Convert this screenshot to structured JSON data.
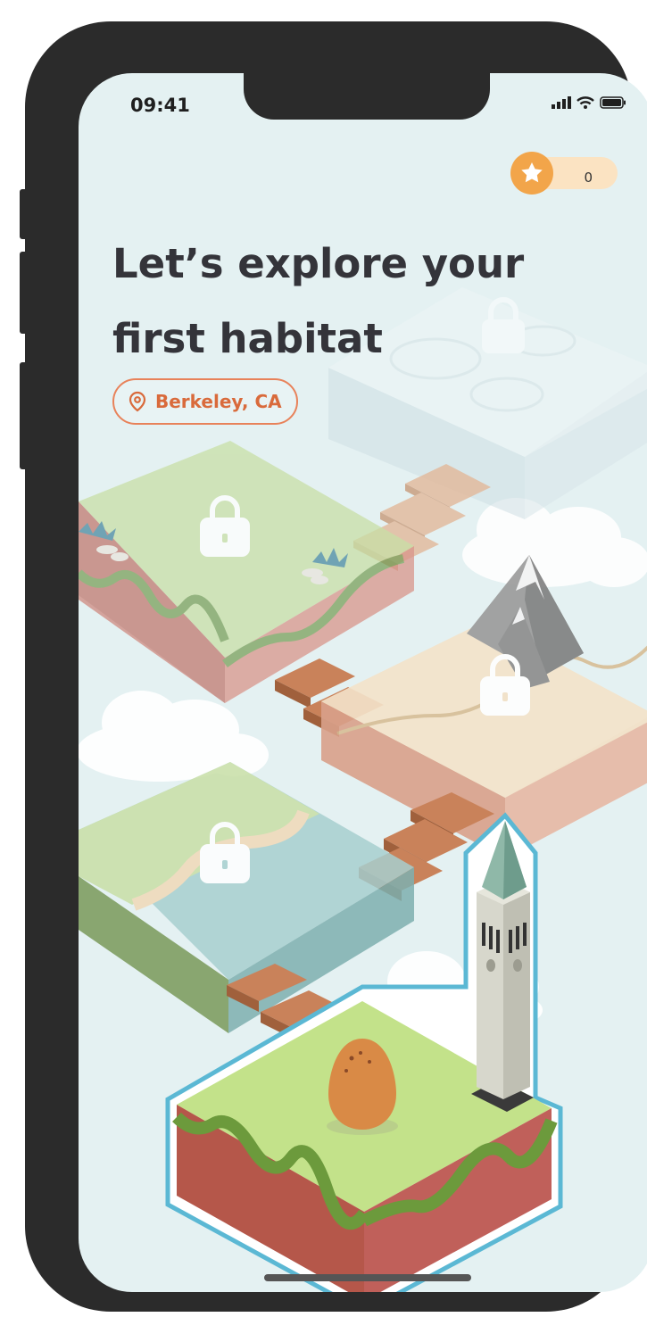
{
  "status_bar": {
    "time": "09:41"
  },
  "score": {
    "value": "0",
    "icon": "star-icon"
  },
  "title": {
    "line1": "Let’s explore your",
    "line2": "first habitat"
  },
  "location": {
    "label": "Berkeley, CA",
    "icon": "location-pin-icon"
  },
  "habitats": [
    {
      "name": "habitat-frozen",
      "state": "locked"
    },
    {
      "name": "habitat-grassland",
      "state": "locked"
    },
    {
      "name": "habitat-mountain-desert",
      "state": "locked"
    },
    {
      "name": "habitat-river",
      "state": "locked"
    },
    {
      "name": "habitat-home-campanile",
      "state": "selected"
    }
  ],
  "colors": {
    "screen_bg": "#e4f1f2",
    "accent_orange": "#e8825a",
    "selected_outline": "#5bb8d4",
    "grass": "#c3e28a",
    "soil": "#b5574a"
  }
}
